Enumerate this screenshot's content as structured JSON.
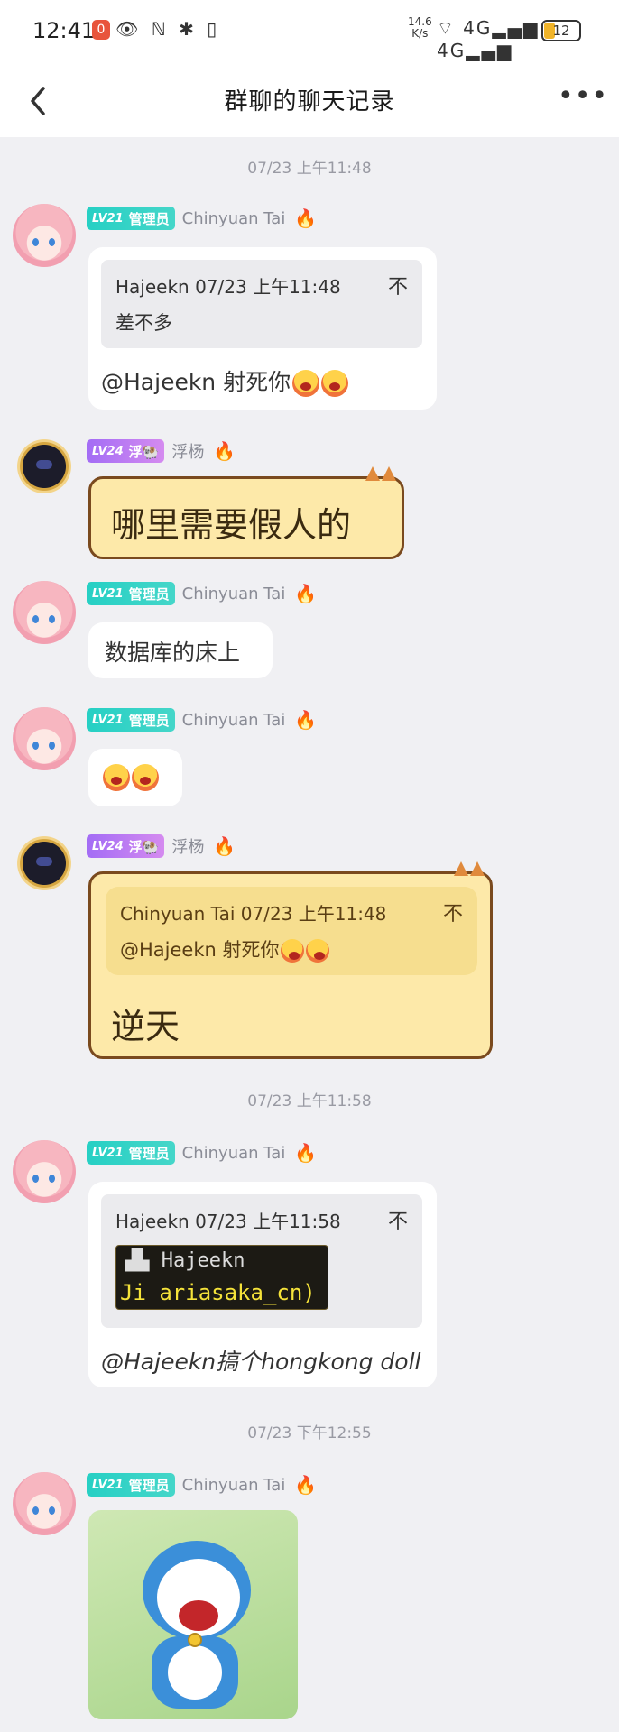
{
  "status_bar": {
    "time": "12:41",
    "badge": "0",
    "speed": "14.6\nK/s",
    "battery": "12",
    "left_icons": "👁 ℕ ✱ ▯",
    "right_icons": "⌔ 4G▂▄▆ 4G▂▄▆"
  },
  "header": {
    "title": "群聊的聊天记录",
    "more": "•••"
  },
  "timestamps": [
    "07/23 上午11:48",
    "07/23 上午11:58",
    "07/23 下午12:55"
  ],
  "users": {
    "chinyuan": {
      "name": "Chinyuan Tai",
      "level": "LV21",
      "role": "管理员"
    },
    "fuyang": {
      "name": "浮杨",
      "level": "LV24",
      "role": "浮🐏"
    }
  },
  "messages": [
    {
      "quote_head": "Hajeekn 07/23 上午11:48",
      "quote_body": "差不多",
      "text": "@Hajeekn 射死你"
    },
    {
      "text": "哪里需要假人的"
    },
    {
      "text": "数据库的床上"
    },
    {
      "text": ""
    },
    {
      "quote_head": "Chinyuan Tai 07/23 上午11:48",
      "quote_body": "@Hajeekn 射死你",
      "text": "逆天"
    },
    {
      "quote_head": "Hajeekn 07/23 上午11:58",
      "image_line1": "▟▙ Hajeekn",
      "image_line2": "Ji ariasaka_cn)",
      "text": "@Hajeekn搞个hongkong doll"
    },
    {
      "image": "doraemon"
    }
  ],
  "quote_pin": "不"
}
